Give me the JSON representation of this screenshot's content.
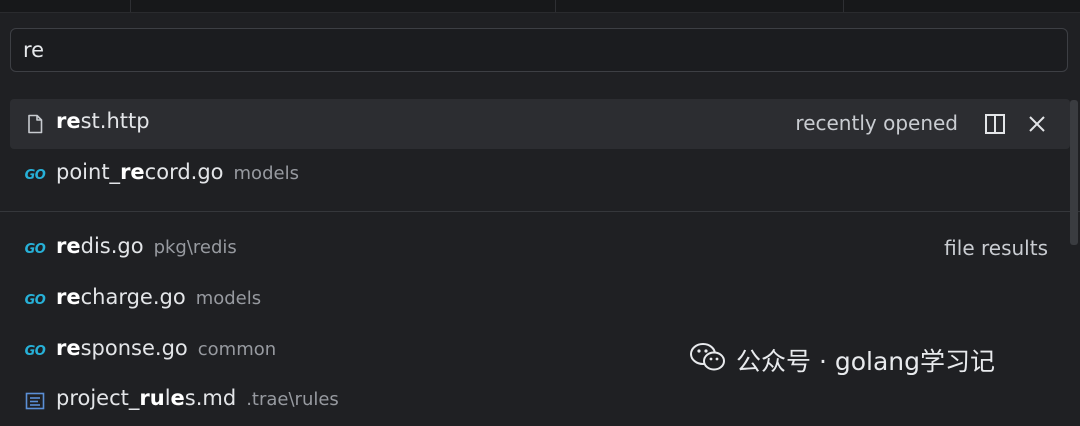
{
  "search": {
    "value": "re"
  },
  "results": [
    {
      "icon": "file-icon",
      "name_bold": "re",
      "name_rest": "st.http",
      "desc": "",
      "right_label": "recently opened"
    },
    {
      "icon": "go-file-icon",
      "name_pre": "point_",
      "name_bold": "re",
      "name_rest": "cord.go",
      "desc": "models"
    },
    {
      "icon": "go-file-icon",
      "name_bold": "re",
      "name_rest": "dis.go",
      "desc": "pkg\\redis",
      "right_label": "file results"
    },
    {
      "icon": "go-file-icon",
      "name_bold": "re",
      "name_rest": "charge.go",
      "desc": "models"
    },
    {
      "icon": "go-file-icon",
      "name_bold": "re",
      "name_rest": "sponse.go",
      "desc": "common"
    },
    {
      "icon": "markdown-file-icon",
      "name_pre": "project_",
      "name_bold": "ru",
      "name_mid": "l",
      "name_bold2": "e",
      "name_rest": "s.md",
      "desc": ".trae\\rules"
    }
  ],
  "icons": {
    "go_text": "GO"
  },
  "watermark": {
    "text": "公众号 · golang学习记"
  },
  "colors": {
    "accent": "#27b1d8",
    "background": "#1f2023",
    "selected": "#2c2d31"
  }
}
